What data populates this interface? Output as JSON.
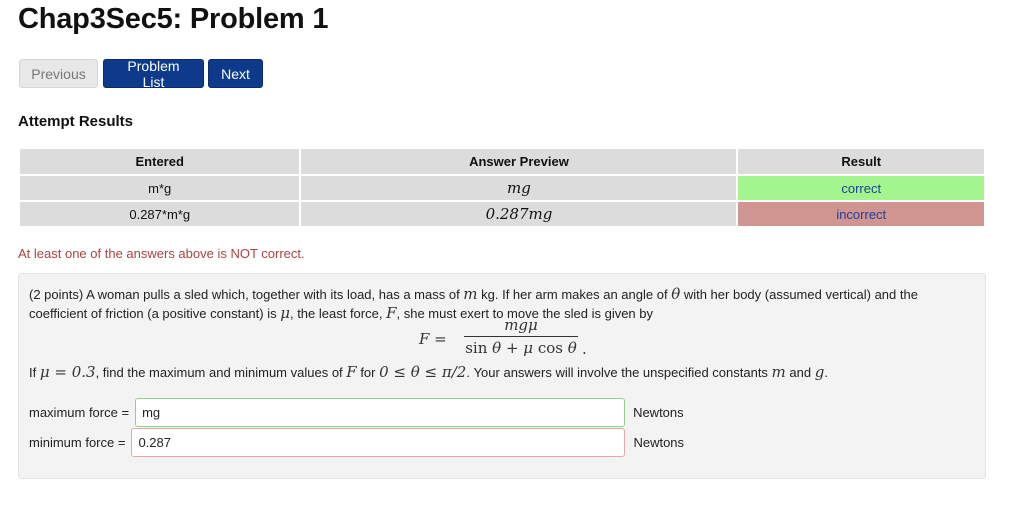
{
  "page": {
    "title": "Chap3Sec5: Problem 1"
  },
  "nav": {
    "previous": "Previous",
    "problem_list": "Problem List",
    "next": "Next"
  },
  "attempt": {
    "heading": "Attempt Results",
    "headers": {
      "entered": "Entered",
      "preview": "Answer Preview",
      "result": "Result"
    },
    "rows": [
      {
        "entered": "m*g",
        "preview": "mg",
        "result": "correct"
      },
      {
        "entered": "0.287*m*g",
        "preview": "0.287mg",
        "result": "incorrect"
      }
    ],
    "warning": "At least one of the answers above is NOT correct."
  },
  "problem": {
    "points": "(2 points)",
    "text_a": " A woman pulls a sled which, together with its load, has a mass of ",
    "sym_m": "m",
    "text_b": " kg. If her arm makes an angle of ",
    "sym_theta": "θ",
    "text_c": " with her body (assumed vertical) and the coefficient of friction (a positive constant) is ",
    "sym_mu": "μ",
    "text_d": ", the least force, ",
    "sym_F": "F",
    "text_e": ", she must exert to move the sled is given by",
    "formula": {
      "lhs": "F =",
      "numerator": "mgμ",
      "den_sin": "sin",
      "den_theta1": "θ",
      "den_plus": " + ",
      "den_mu": "μ",
      "den_cos": " cos",
      "den_theta2": "θ",
      "period": "."
    },
    "line2_if": "If ",
    "line2_mu_eq": "μ = 0.3",
    "line2_a": ", find the maximum and minimum values of ",
    "line2_F": "F",
    "line2_b": " for ",
    "line2_range": "0 ≤ θ ≤ π/2",
    "line2_c": ". Your answers will involve the unspecified constants ",
    "line2_m": "m",
    "line2_and": " and ",
    "line2_g": "g",
    "line2_end": "."
  },
  "answers": {
    "max": {
      "label": "maximum force =",
      "value": "mg",
      "unit": "Newtons",
      "status": "correct"
    },
    "min": {
      "label": "minimum force =",
      "value": "0.287",
      "unit": "Newtons",
      "status": "incorrect"
    }
  },
  "colors": {
    "primary_button": "#0e3a8c",
    "correct_bg": "#a3f58e",
    "incorrect_bg": "#d19591",
    "warning_text": "#a94442",
    "result_text": "#1d3fa0"
  }
}
